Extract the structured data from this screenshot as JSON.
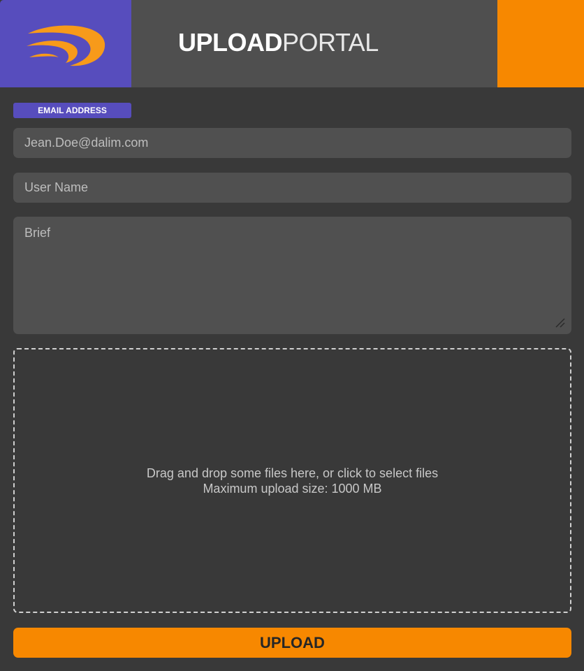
{
  "header": {
    "title_bold": "UPLOAD",
    "title_light": "PORTAL",
    "logo_icon": "swoosh-logo-icon"
  },
  "form": {
    "email_label": "EMAIL ADDRESS",
    "email_placeholder": "Jean.Doe@dalim.com",
    "username_placeholder": "User Name",
    "brief_placeholder": "Brief"
  },
  "dropzone": {
    "line1": "Drag and drop some files here, or click to select files",
    "line2": "Maximum upload size: 1000 MB"
  },
  "upload_button": "UPLOAD",
  "colors": {
    "brand_purple": "#574dbd",
    "accent_orange": "#f78800",
    "background": "#393939",
    "field_bg": "#505050"
  }
}
